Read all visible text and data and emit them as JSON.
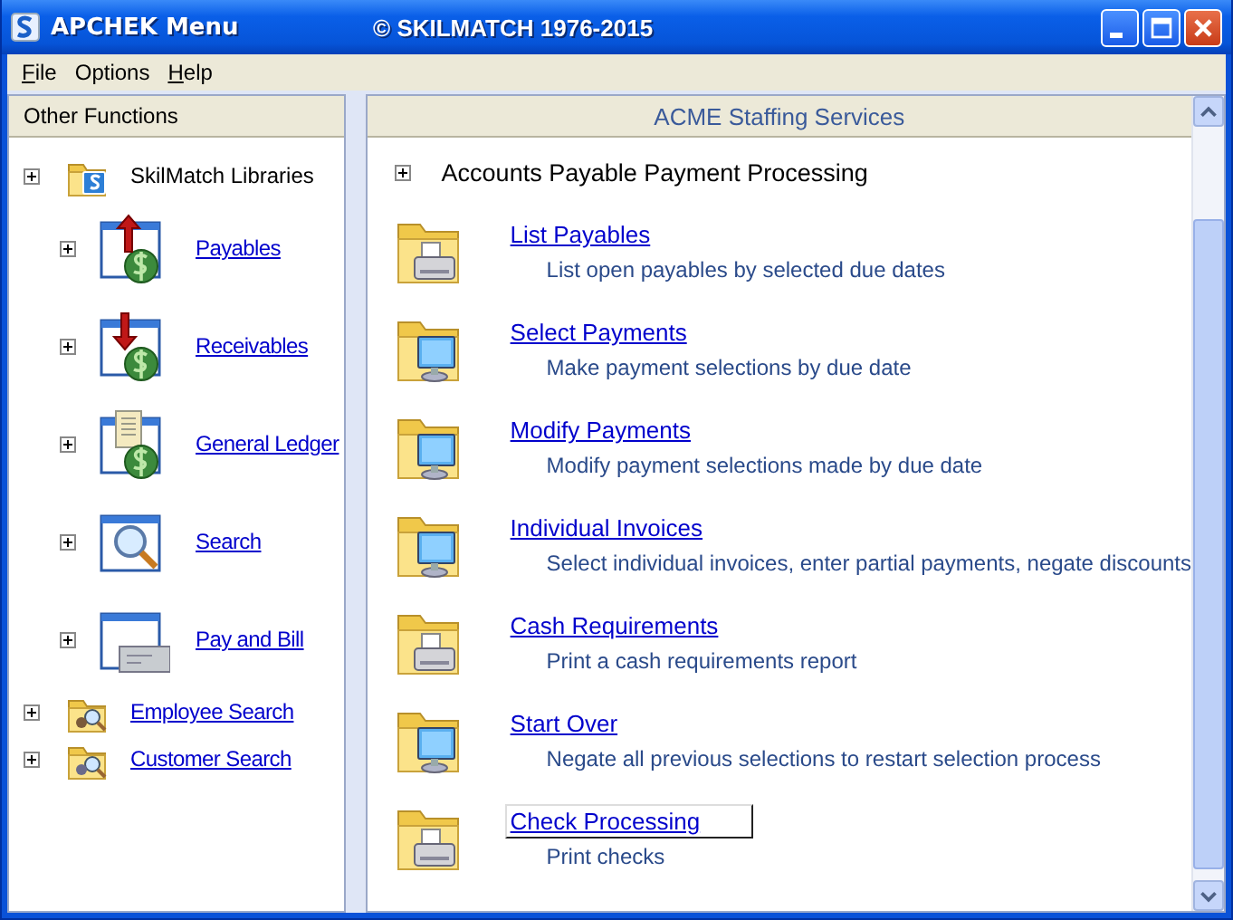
{
  "window": {
    "title": "APCHEK Menu",
    "subtitle": "© SKILMATCH 1976-2015"
  },
  "menu": [
    {
      "label": "File",
      "mnemonic_underlined": true
    },
    {
      "label": "Options",
      "mnemonic_underlined": false
    },
    {
      "label": "Help",
      "mnemonic_underlined": true
    }
  ],
  "sidebar": {
    "title": "Other Functions",
    "items": [
      {
        "label": "SkilMatch Libraries",
        "kind": "text",
        "children": [
          {
            "label": "Payables",
            "kind": "link"
          },
          {
            "label": "Receivables",
            "kind": "link"
          },
          {
            "label": "General Ledger",
            "kind": "link"
          },
          {
            "label": "Search",
            "kind": "link"
          },
          {
            "label": "Pay and Bill",
            "kind": "link"
          }
        ]
      },
      {
        "label": "Employee Search",
        "kind": "link"
      },
      {
        "label": "Customer Search",
        "kind": "link"
      }
    ]
  },
  "main": {
    "title": "ACME Staffing Services",
    "section": "Accounts Payable Payment Processing",
    "tasks": [
      {
        "title": "List Payables",
        "description": "List open payables by selected due dates",
        "focused": false
      },
      {
        "title": "Select Payments",
        "description": "Make payment selections by due date",
        "focused": false
      },
      {
        "title": "Modify Payments",
        "description": "Modify payment selections made by due date",
        "focused": false
      },
      {
        "title": "Individual Invoices",
        "description": "Select individual invoices, enter partial payments, negate discounts",
        "focused": false
      },
      {
        "title": "Cash Requirements",
        "description": "Print a cash requirements report",
        "focused": false
      },
      {
        "title": "Start Over",
        "description": "Negate all previous selections to restart selection process",
        "focused": false
      },
      {
        "title": "Check Processing",
        "description": "Print checks",
        "focused": true
      }
    ]
  }
}
